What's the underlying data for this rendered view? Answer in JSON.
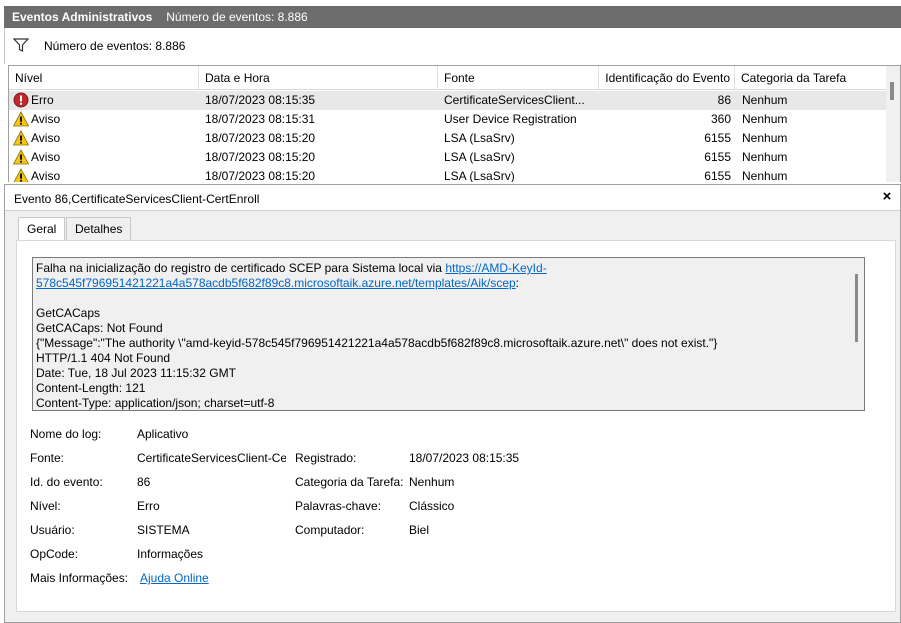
{
  "header": {
    "title": "Eventos Administrativos",
    "event_count": "Número de eventos: 8.886"
  },
  "filterbar": {
    "count_label": "Número de eventos: 8.886"
  },
  "grid": {
    "columns": [
      "Nível",
      "Data e Hora",
      "Fonte",
      "Identificação do Evento",
      "Categoria da Tarefa"
    ],
    "rows": [
      {
        "level": "Erro",
        "icon": "error-icon",
        "datetime": "18/07/2023 08:15:35",
        "source": "CertificateServicesClient...",
        "id": "86",
        "category": "Nenhum"
      },
      {
        "level": "Aviso",
        "icon": "warning-icon",
        "datetime": "18/07/2023 08:15:31",
        "source": "User Device Registration",
        "id": "360",
        "category": "Nenhum"
      },
      {
        "level": "Aviso",
        "icon": "warning-icon",
        "datetime": "18/07/2023 08:15:20",
        "source": "LSA (LsaSrv)",
        "id": "6155",
        "category": "Nenhum"
      },
      {
        "level": "Aviso",
        "icon": "warning-icon",
        "datetime": "18/07/2023 08:15:20",
        "source": "LSA (LsaSrv)",
        "id": "6155",
        "category": "Nenhum"
      },
      {
        "level": "Aviso",
        "icon": "warning-icon",
        "datetime": "18/07/2023 08:15:20",
        "source": "LSA (LsaSrv)",
        "id": "6155",
        "category": "Nenhum"
      }
    ]
  },
  "detail": {
    "title": "Evento 86,CertificateServicesClient-CertEnroll",
    "close_label": "×",
    "tabs": [
      "Geral",
      "Detalhes"
    ],
    "message": {
      "line1_prefix": "Falha na inicialização do registro de certificado SCEP para Sistema local via ",
      "link_part1": "https://AMD-KeyId-",
      "link_part2": "578c545f796951421221a4a578acdb5f682f89c8.microsoftaik.azure.net/templates/Aik/scep",
      "line2_suffix": ":",
      "lines": [
        "GetCACaps",
        "GetCACaps: Not Found",
        "{\"Message\":\"The authority \\\"amd-keyid-578c545f796951421221a4a578acdb5f682f89c8.microsoftaik.azure.net\\\" does not exist.\"}",
        "HTTP/1.1 404 Not Found",
        "Date: Tue, 18 Jul 2023 11:15:32 GMT",
        "Content-Length: 121",
        "Content-Type: application/json; charset=utf-8"
      ]
    },
    "props": {
      "log_name_label": "Nome do log:",
      "log_name_value": "Aplicativo",
      "source_label": "Fonte:",
      "source_value": "CertificateServicesClient-Cer",
      "registered_label": "Registrado:",
      "registered_value": "18/07/2023 08:15:35",
      "event_id_label": "Id. do evento:",
      "event_id_value": "86",
      "task_category_label": "Categoria da Tarefa:",
      "task_category_value": "Nenhum",
      "level_label": "Nível:",
      "level_value": "Erro",
      "keywords_label": "Palavras-chave:",
      "keywords_value": "Clássico",
      "user_label": "Usuário:",
      "user_value": "SISTEMA",
      "computer_label": "Computador:",
      "computer_value": "Biel",
      "opcode_label": "OpCode:",
      "opcode_value": "Informações",
      "more_info_label": "Mais Informações:",
      "more_info_link": "Ajuda Online"
    }
  }
}
